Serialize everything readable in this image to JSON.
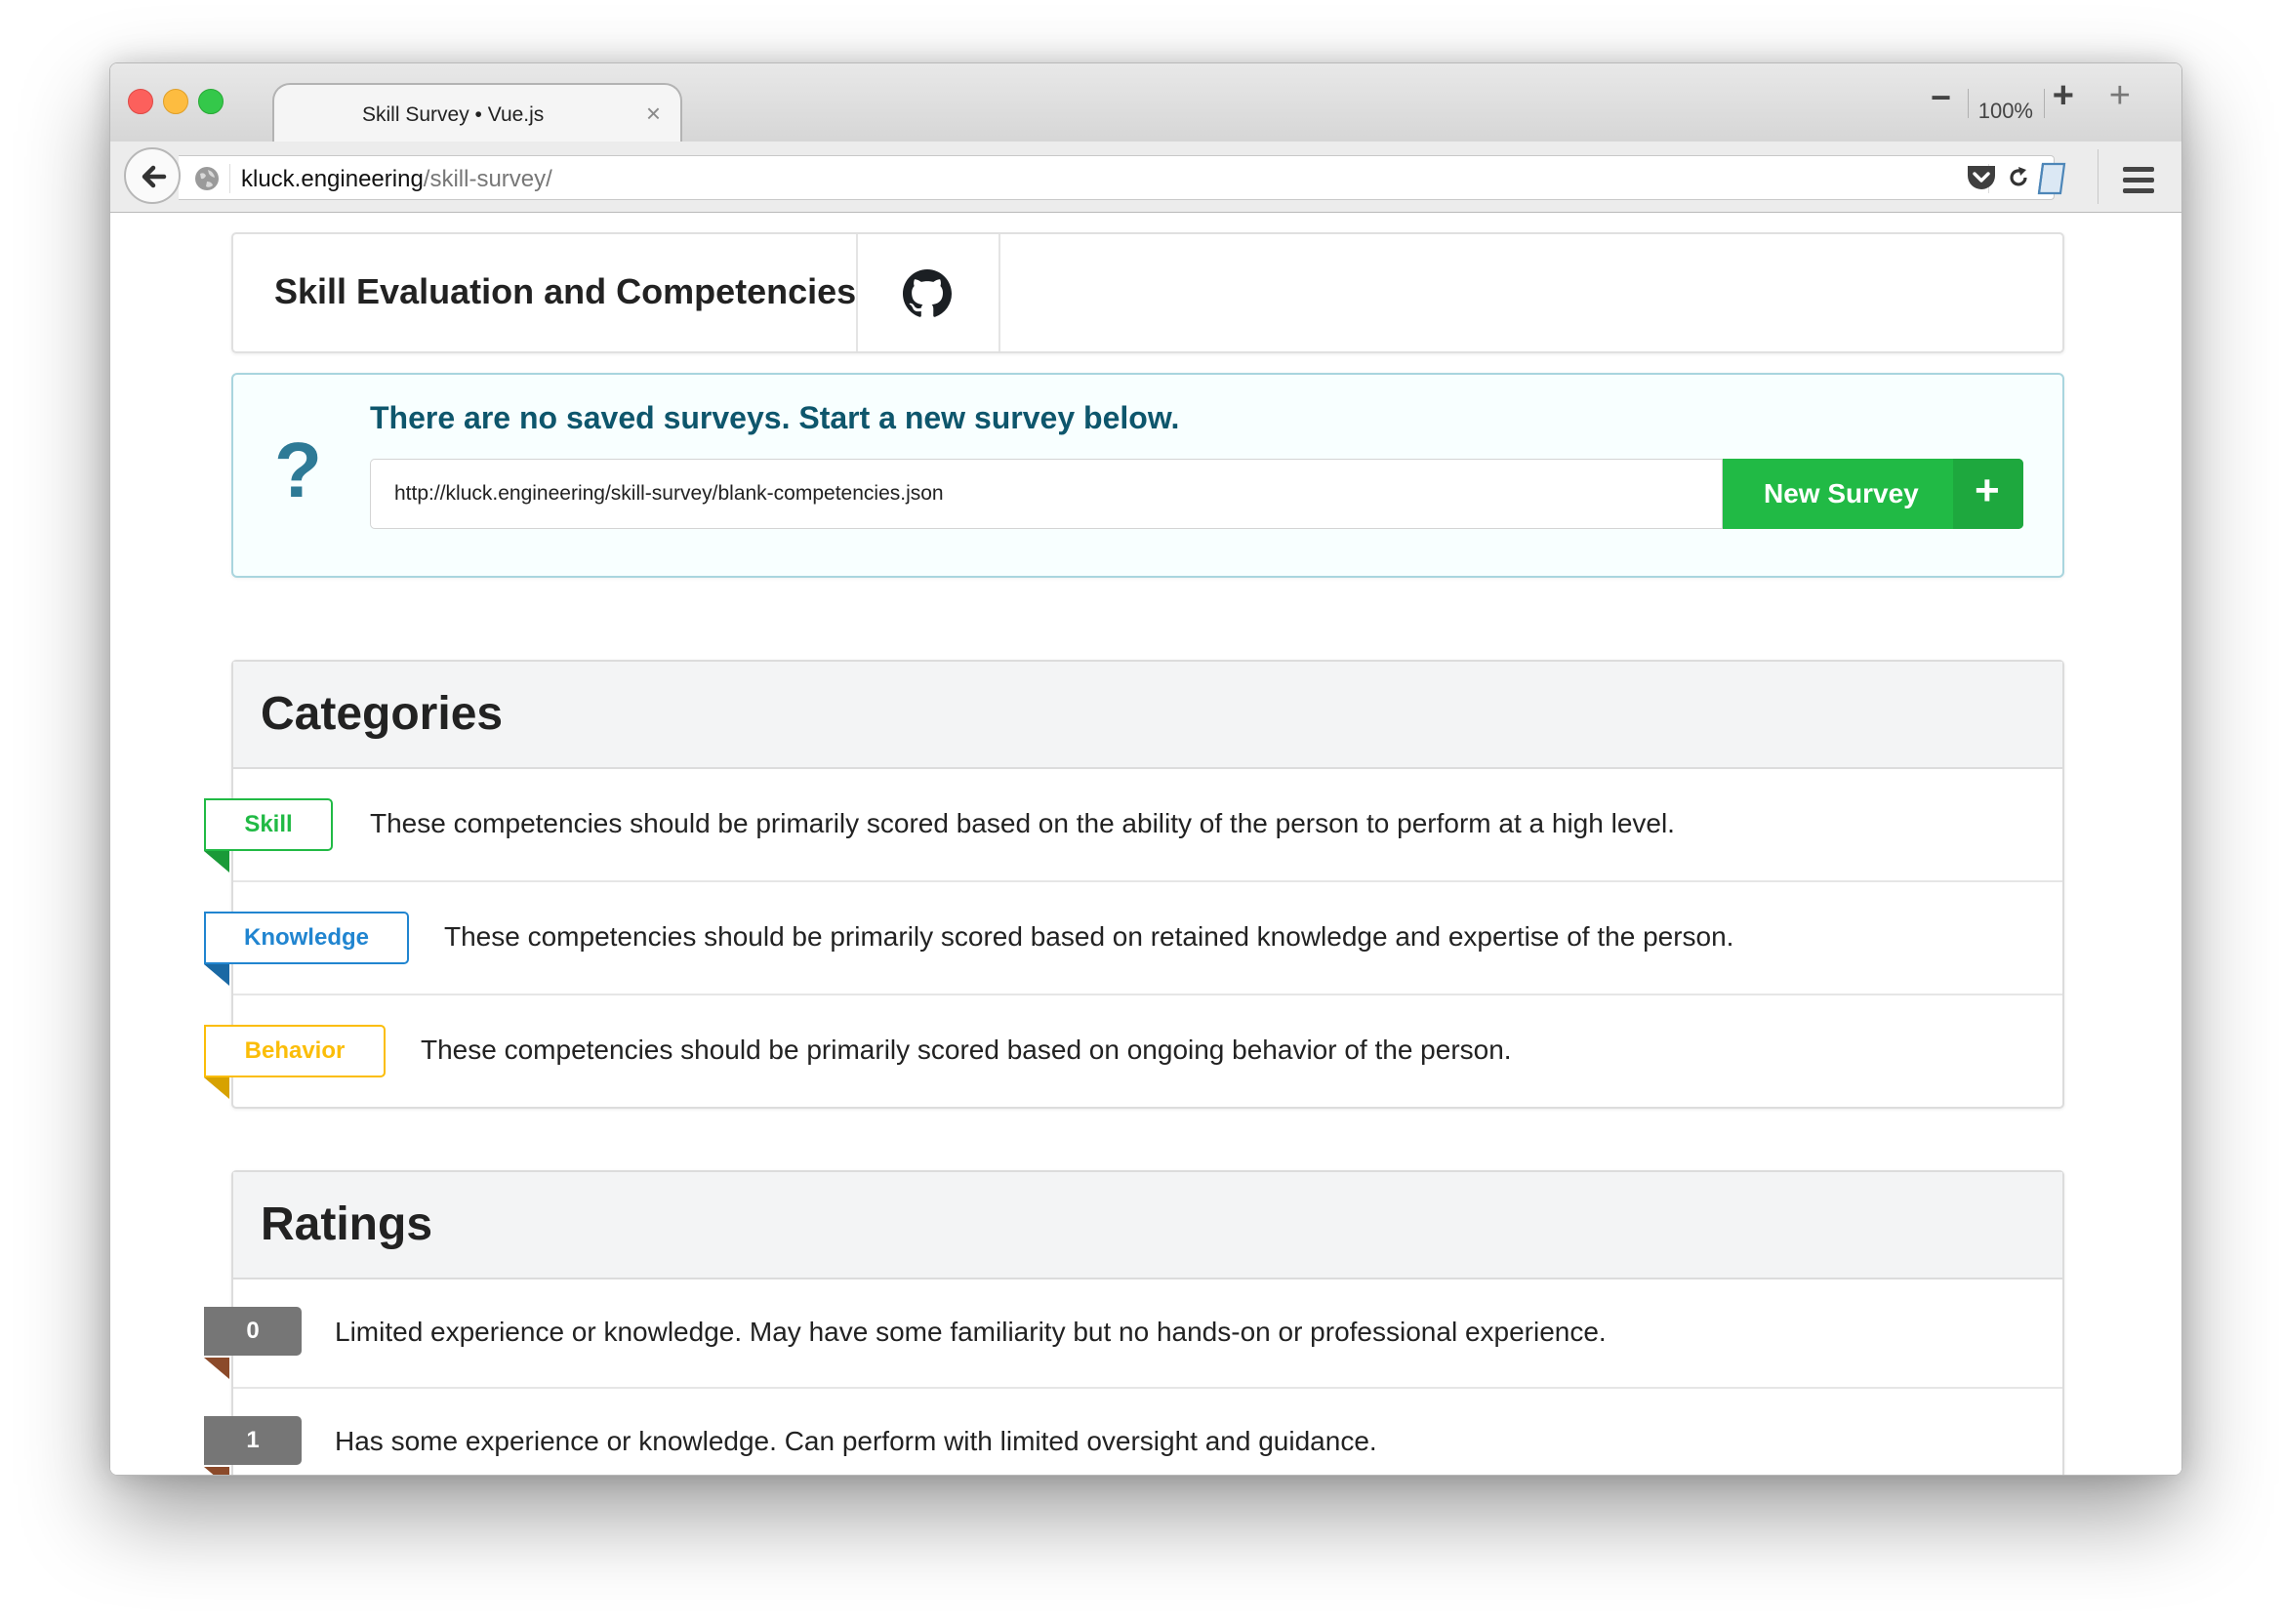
{
  "browser": {
    "tab_title": "Skill Survey • Vue.js",
    "tab_close": "×",
    "zoom_level": "100%",
    "zoom_out": "−",
    "zoom_in": "+",
    "new_tab": "+",
    "url_host": "kluck.engineering",
    "url_path": "/skill-survey/"
  },
  "header": {
    "title": "Skill Evaluation and Competencies",
    "github_icon": "github-icon"
  },
  "info": {
    "icon": "?",
    "message": "There are no saved surveys. Start a new survey below.",
    "survey_url": "http://kluck.engineering/skill-survey/blank-competencies.json",
    "button_label": "New Survey",
    "button_icon": "+"
  },
  "categories": {
    "title": "Categories",
    "items": [
      {
        "label": "Skill",
        "color": "#21ba45",
        "description": "These competencies should be primarily scored based on the ability of the person to perform at a high level."
      },
      {
        "label": "Knowledge",
        "color": "#2185d0",
        "description": "These competencies should be primarily scored based on retained knowledge and expertise of the person."
      },
      {
        "label": "Behavior",
        "color": "#fbbd08",
        "description": "These competencies should be primarily scored based on ongoing behavior of the person."
      }
    ]
  },
  "ratings": {
    "title": "Ratings",
    "items": [
      {
        "value": "0",
        "description": "Limited experience or knowledge. May have some familiarity but no hands-on or professional experience."
      },
      {
        "value": "1",
        "description": "Has some experience or knowledge. Can perform with limited oversight and guidance."
      }
    ]
  }
}
